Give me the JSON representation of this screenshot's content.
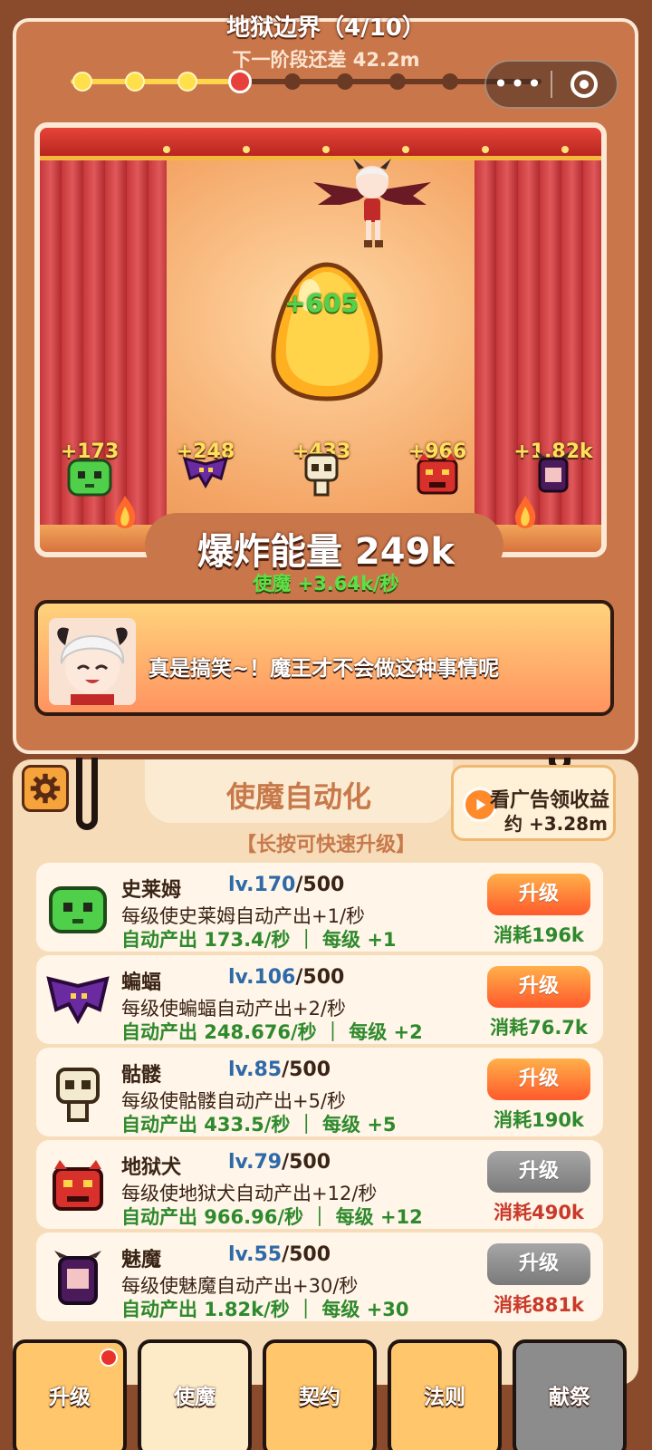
{
  "stage": {
    "title": "地狱边界（4/10）",
    "next_phase": "下一阶段还差 42.2m",
    "progress": {
      "completed": 3,
      "current": 4,
      "total": 10
    }
  },
  "capsule": {
    "more_icon": "more-dots-icon",
    "close_icon": "target-close-icon"
  },
  "scene": {
    "egg_value": "+605",
    "minion_values": [
      "+173",
      "+248",
      "+433",
      "+966",
      "+1.82k"
    ],
    "energy": "爆炸能量 249k",
    "rate": "使魔 +3.64k/秒"
  },
  "dialog": {
    "text": "真是搞笑~！魔王才不会做这种事情呢"
  },
  "panel": {
    "title": "使魔自动化",
    "hint": "【长按可快速升级】",
    "ad_line1": "看广告领收益",
    "ad_line2": "约 +3.28m"
  },
  "minions": [
    {
      "name": "史莱姆",
      "level": "lv.170",
      "max": "/500",
      "desc": "每级使史莱姆自动产出+1/秒",
      "auto": "自动产出 173.4/秒 ｜ 每级 +1",
      "button": "升级",
      "cost": "消耗196k",
      "affordable": true
    },
    {
      "name": "蝙蝠",
      "level": "lv.106",
      "max": "/500",
      "desc": "每级使蝙蝠自动产出+2/秒",
      "auto": "自动产出 248.676/秒 ｜ 每级 +2",
      "button": "升级",
      "cost": "消耗76.7k",
      "affordable": true
    },
    {
      "name": "骷髅",
      "level": "lv.85",
      "max": "/500",
      "desc": "每级使骷髅自动产出+5/秒",
      "auto": "自动产出 433.5/秒 ｜ 每级 +5",
      "button": "升级",
      "cost": "消耗190k",
      "affordable": true
    },
    {
      "name": "地狱犬",
      "level": "lv.79",
      "max": "/500",
      "desc": "每级使地狱犬自动产出+12/秒",
      "auto": "自动产出 966.96/秒 ｜ 每级 +12",
      "button": "升级",
      "cost": "消耗490k",
      "affordable": false
    },
    {
      "name": "魅魔",
      "level": "lv.55",
      "max": "/500",
      "desc": "每级使魅魔自动产出+30/秒",
      "auto": "自动产出 1.82k/秒 ｜ 每级 +30",
      "button": "升级",
      "cost": "消耗881k",
      "affordable": false
    }
  ],
  "tabs": [
    {
      "label": "升级",
      "badge": true
    },
    {
      "label": "使魔",
      "active": true
    },
    {
      "label": "契约"
    },
    {
      "label": "法则"
    },
    {
      "label": "献祭",
      "locked": true
    }
  ],
  "colors": {
    "accent": "#ff5a2c",
    "positive": "#2e8a2c",
    "negative": "#c93a2a",
    "level": "#2e6aa8"
  }
}
